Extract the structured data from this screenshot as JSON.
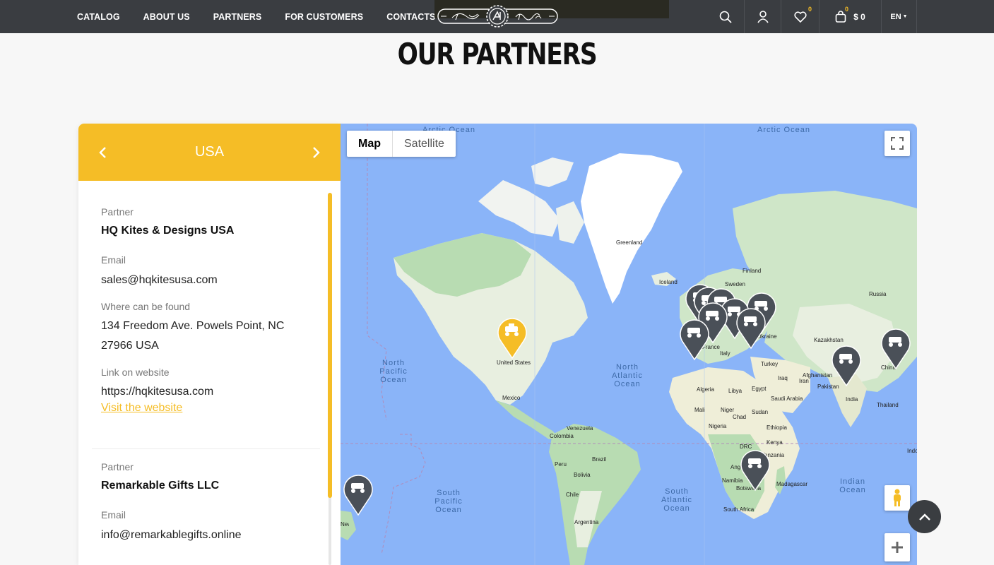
{
  "nav": {
    "items": [
      "CATALOG",
      "ABOUT US",
      "PARTNERS",
      "FOR CUSTOMERS",
      "CONTACTS"
    ],
    "wishlist_count": "0",
    "cart_count": "0",
    "cart_total": "$ 0",
    "language": "EN"
  },
  "page": {
    "title": "OUR PARTNERS"
  },
  "partners_panel": {
    "country": "USA",
    "entries": [
      {
        "partner_label": "Partner",
        "partner_name": "HQ Kites & Designs USA",
        "email_label": "Email",
        "email": "sales@hqkitesusa.com",
        "location_label": "Where can be found",
        "address_line1": "134 Freedom Ave. Powels Point, NC",
        "address_line2": "27966 USA",
        "website_label": "Link on website",
        "website": "https://hqkitesusa.com",
        "visit_label": "Visit the website"
      },
      {
        "partner_label": "Partner",
        "partner_name": "Remarkable Gifts LLC",
        "email_label": "Email",
        "email": "info@remarkablegifts.online"
      }
    ]
  },
  "map": {
    "type_buttons": [
      "Map",
      "Satellite"
    ],
    "active_type": "Map",
    "colors": {
      "water": "#8ab4f8",
      "land": "#e8f0e0",
      "green": "#b7dcb0",
      "pin_active": "#f5bd26",
      "pin_default": "#4a5058"
    },
    "oceans": [
      "Arctic Ocean",
      "Arctic Ocean",
      "North Pacific Ocean",
      "North Atlantic Ocean",
      "South Pacific Ocean",
      "South Atlantic Ocean",
      "Indian Ocean"
    ],
    "places": [
      "Greenland",
      "Iceland",
      "Finland",
      "Sweden",
      "Russia",
      "Kazakhstan",
      "Afghanistan",
      "Pakistan",
      "India",
      "China",
      "Thailand",
      "Indo",
      "Iran",
      "Iraq",
      "Turkey",
      "Ukraine",
      "Italy",
      "France",
      "United States",
      "Mexico",
      "Venezuela",
      "Colombia",
      "Peru",
      "Brazil",
      "Bolivia",
      "Chile",
      "Argentina",
      "Algeria",
      "Libya",
      "Egypt",
      "Mali",
      "Niger",
      "Chad",
      "Sudan",
      "Nigeria",
      "Ethiopia",
      "Saudi Arabia",
      "Kenya",
      "DRC",
      "Tanzania",
      "Angola",
      "Namibia",
      "Botswana",
      "Madagascar",
      "South Africa",
      "New Zealand"
    ]
  }
}
